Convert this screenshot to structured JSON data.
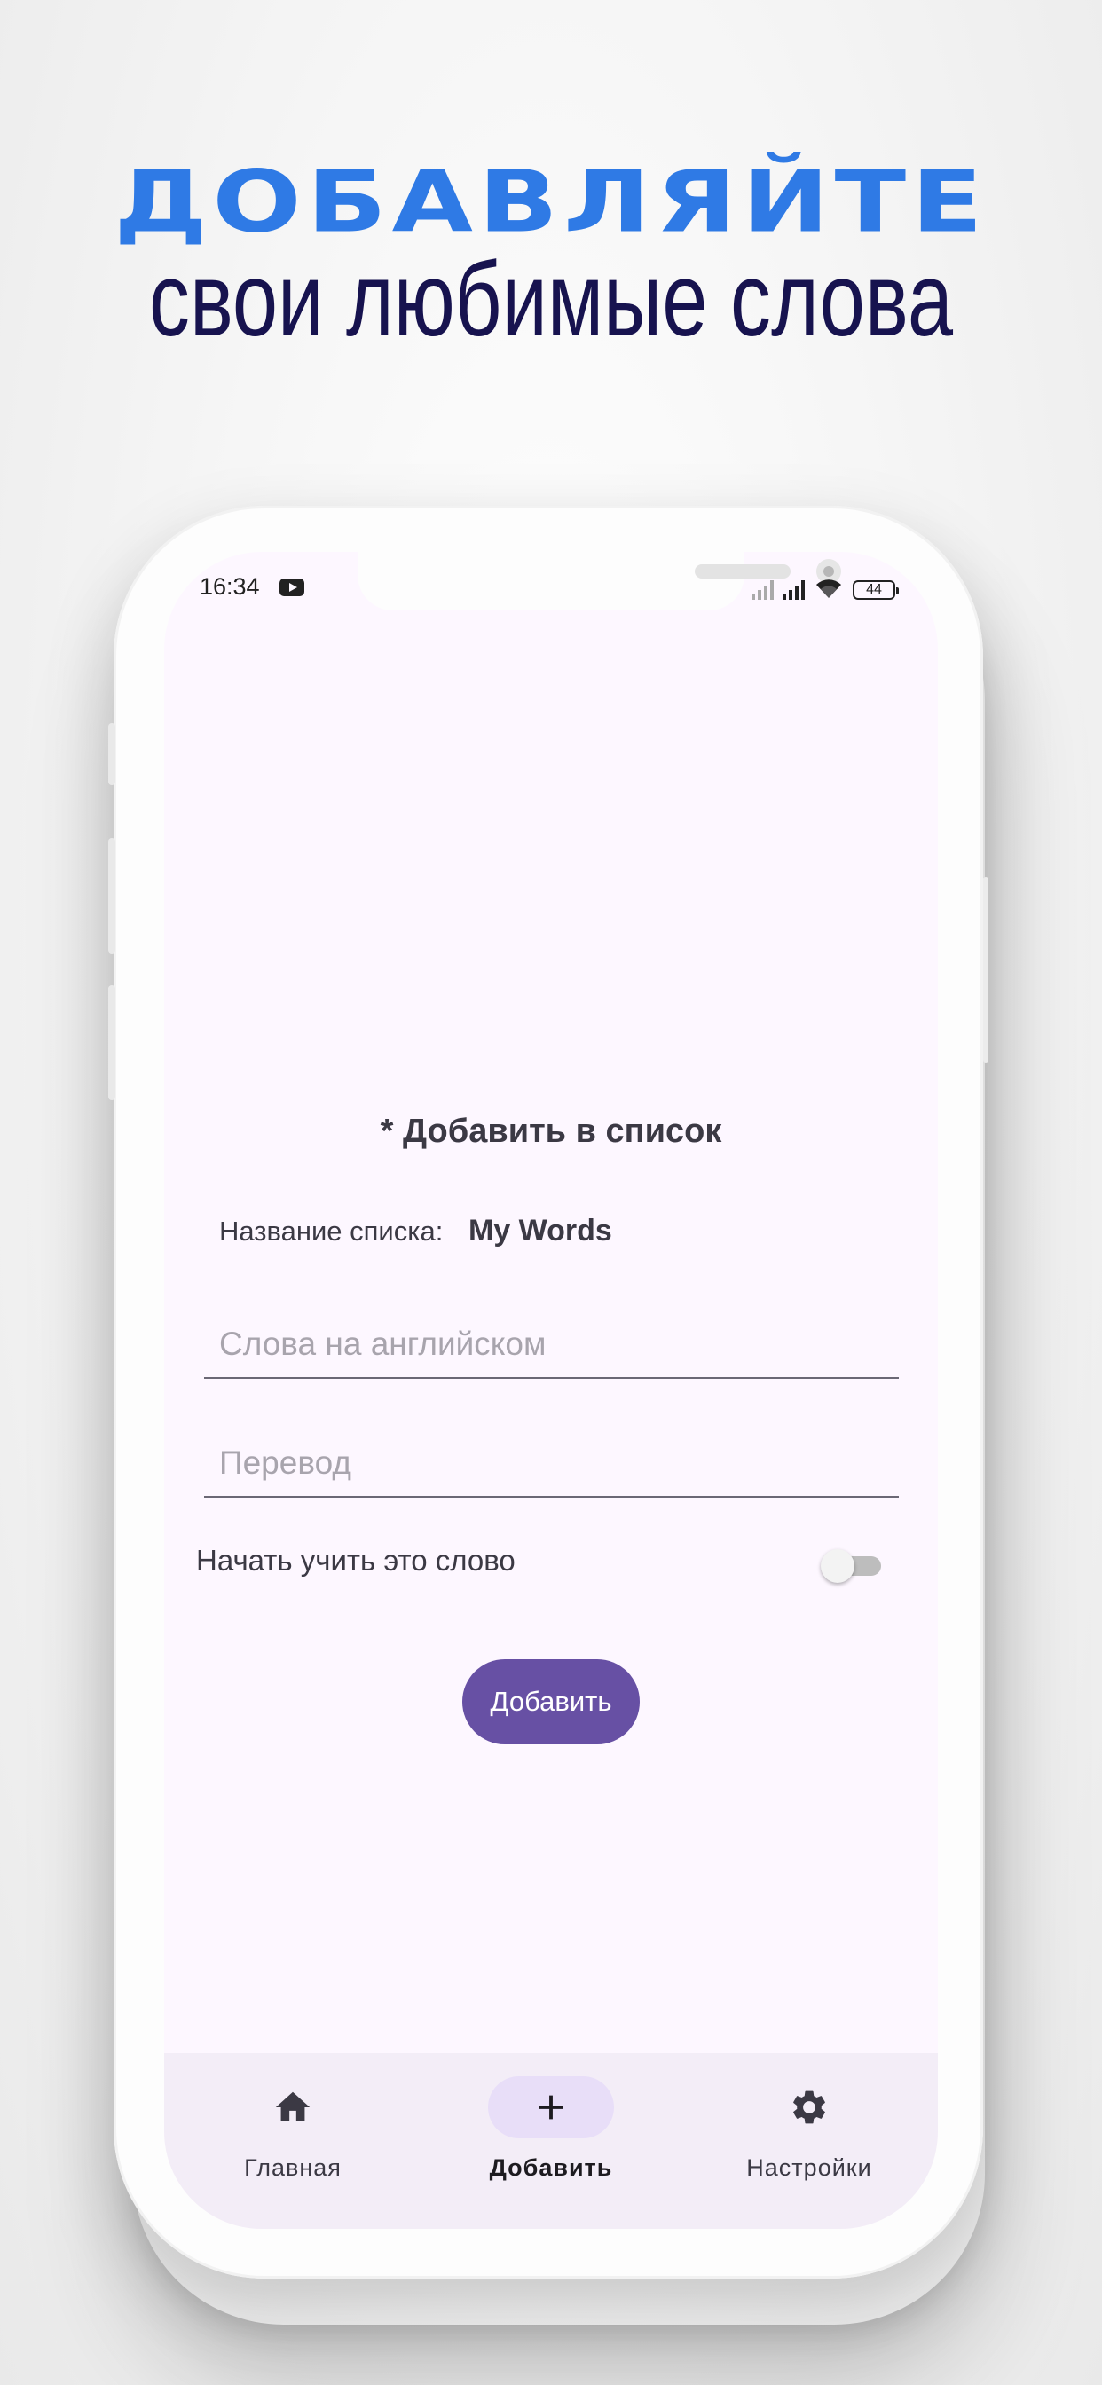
{
  "headline": {
    "line1": "ДОБАВЛЯЙТЕ",
    "line2": "свои любимые слова"
  },
  "status_bar": {
    "time": "16:34",
    "battery": "44"
  },
  "form": {
    "title": "* Добавить в список",
    "list_label": "Название списка:",
    "list_value": "My Words",
    "english_placeholder": "Слова на английском",
    "english_value": "",
    "translation_placeholder": "Перевод",
    "translation_value": "",
    "toggle_label": "Начать учить это слово",
    "toggle_on": false,
    "add_button": "Добавить"
  },
  "bottom_nav": {
    "items": [
      {
        "label": "Главная",
        "icon": "home-icon",
        "active": false
      },
      {
        "label": "Добавить",
        "icon": "plus-icon",
        "active": true
      },
      {
        "label": "Настройки",
        "icon": "gear-icon",
        "active": false
      }
    ]
  },
  "colors": {
    "headline_blue": "#2f7ae5",
    "headline_navy": "#17134f",
    "primary": "#6750a4",
    "screen_bg": "#fdf7ff",
    "nav_bg": "#f3edf7",
    "nav_active_pill": "#e8def8"
  }
}
